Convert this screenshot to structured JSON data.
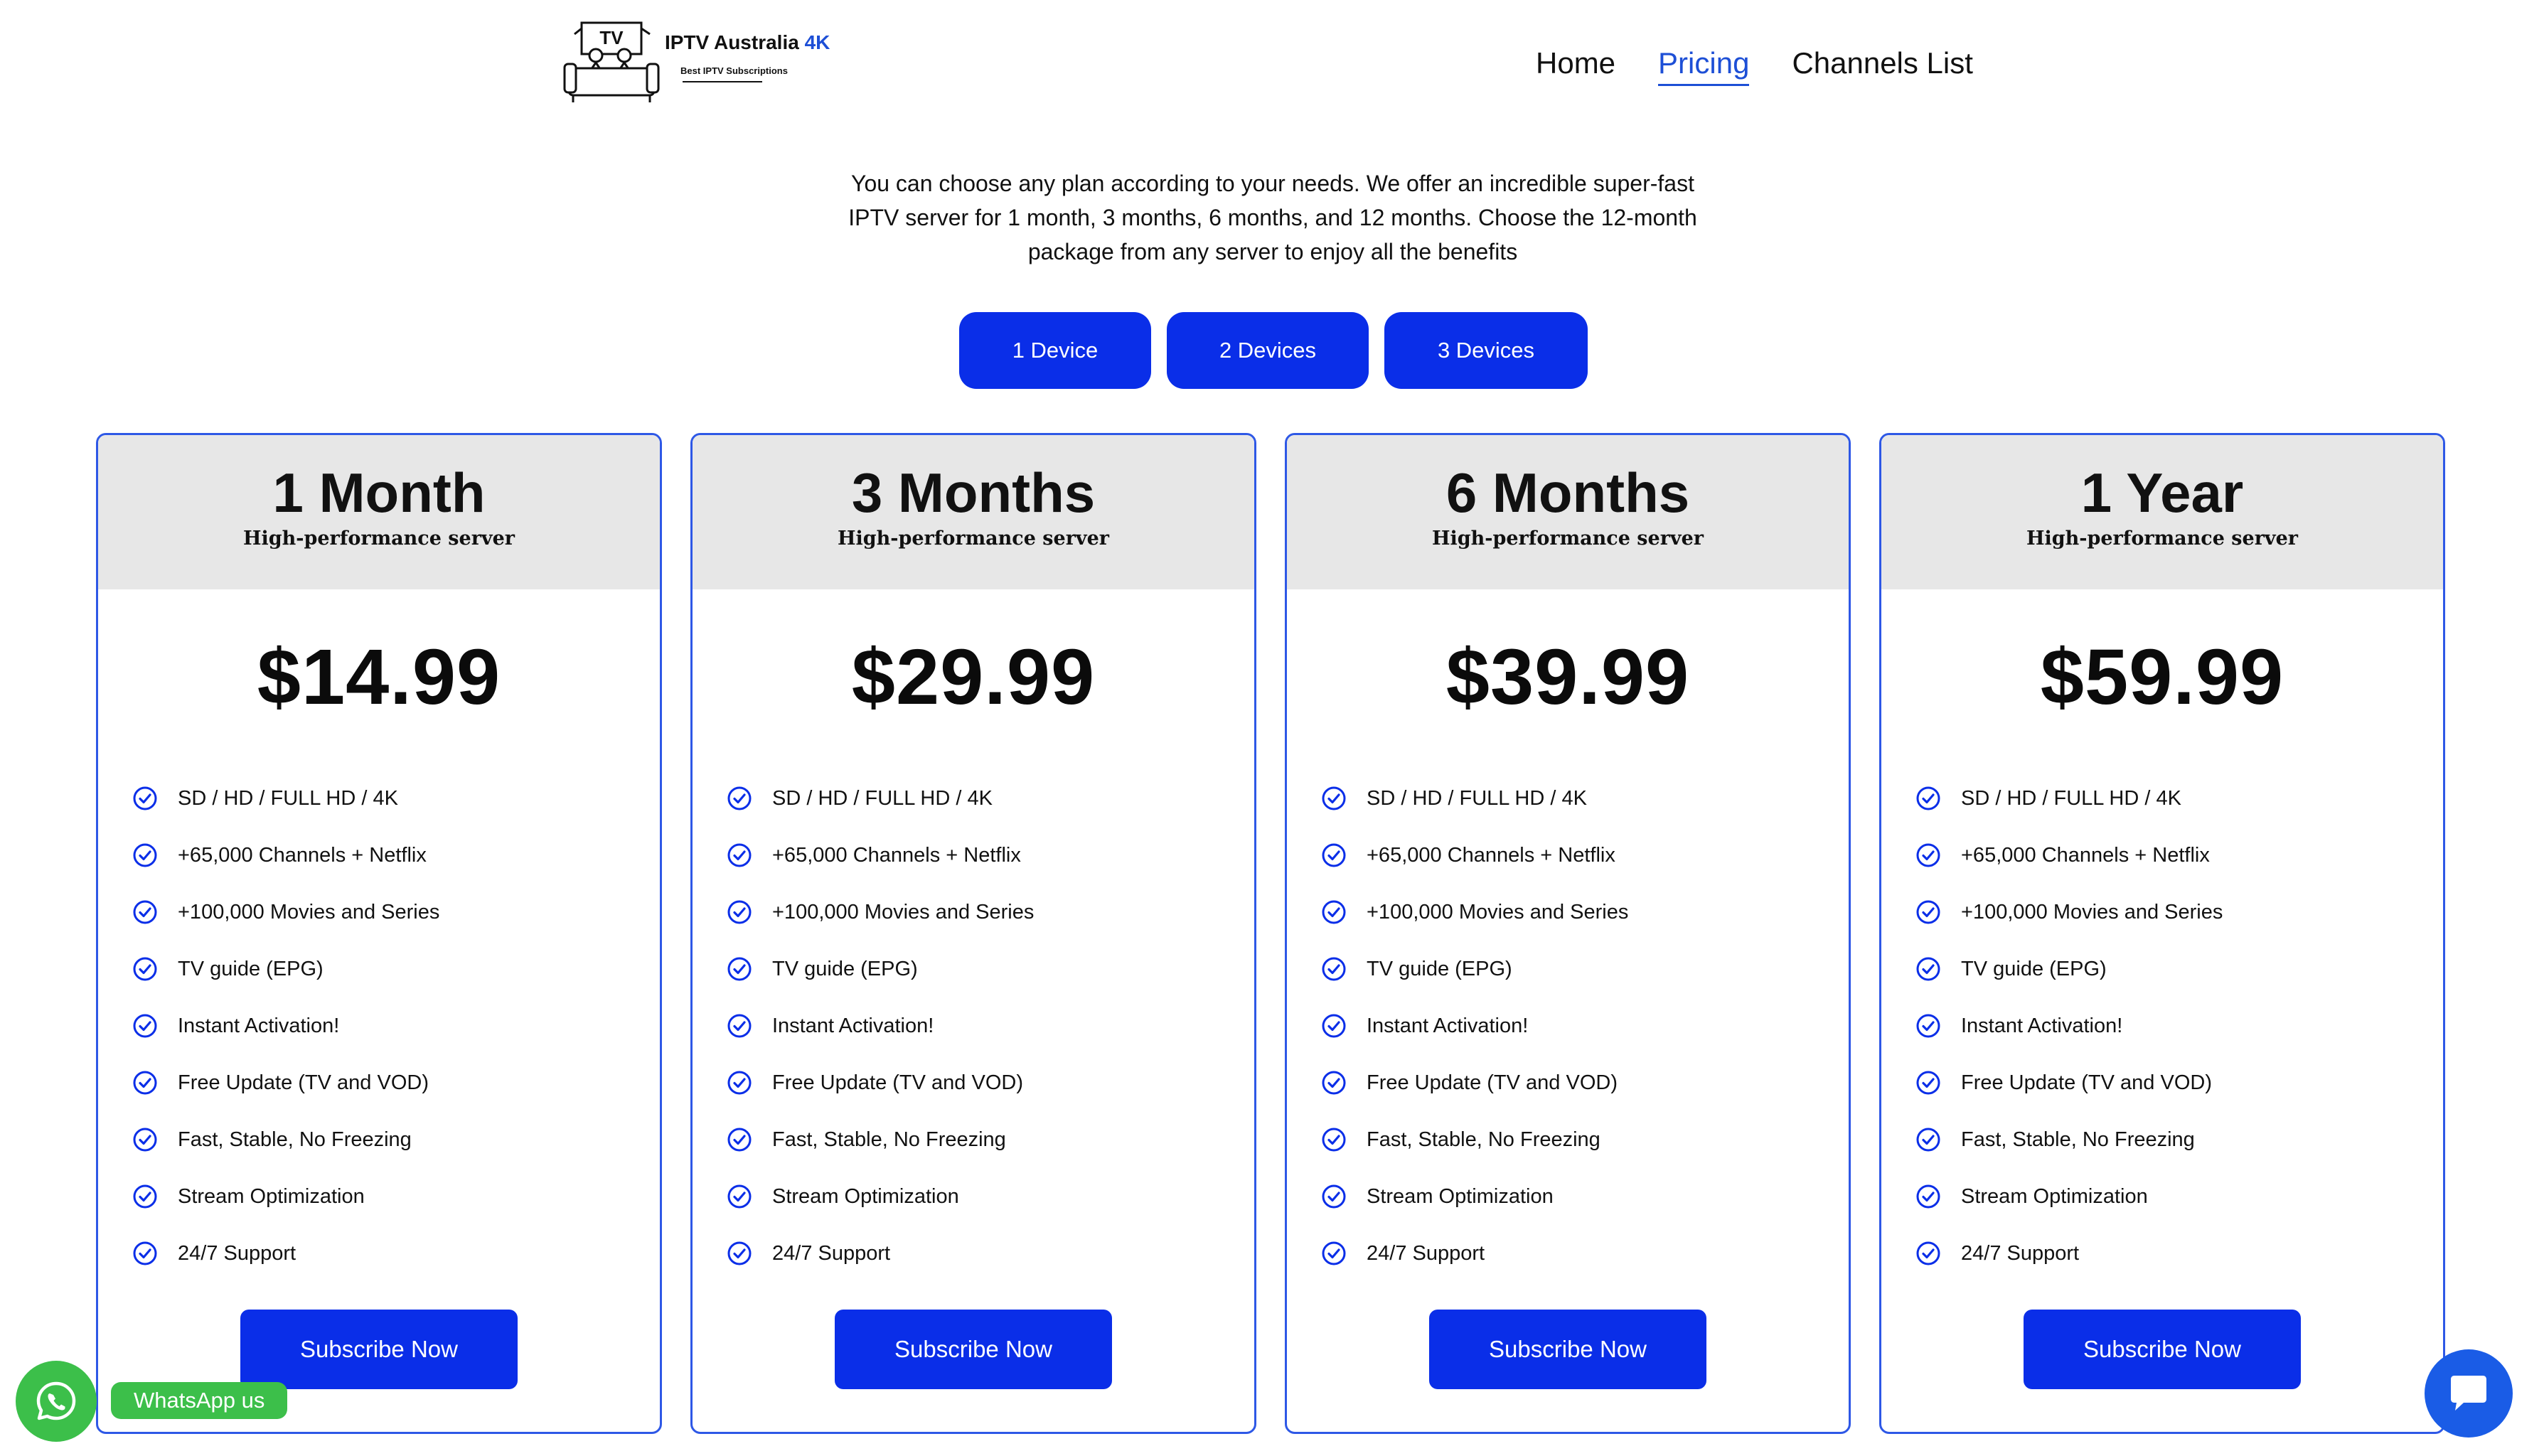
{
  "header": {
    "logo": {
      "art_text": "TV",
      "brand": "IPTV Australia",
      "brand_accent": "4K",
      "tagline": "Best IPTV Subscriptions"
    },
    "nav": [
      {
        "label": "Home",
        "active": false
      },
      {
        "label": "Pricing",
        "active": true
      },
      {
        "label": "Channels List",
        "active": false
      }
    ]
  },
  "intro": {
    "text": "You can choose any plan according to your needs. We offer an incredible super-fast IPTV server for 1 month, 3 months, 6 months, and 12 months. Choose the 12-month package from any server to enjoy all the benefits"
  },
  "device_tabs": [
    {
      "label": "1 Device"
    },
    {
      "label": "2 Devices"
    },
    {
      "label": "3 Devices"
    }
  ],
  "plans": [
    {
      "title": "1 Month",
      "subtitle": "High-performance server",
      "price": "$14.99",
      "features": [
        "SD / HD / FULL HD / 4K",
        "+65,000 Channels + Netflix",
        "+100,000 Movies and Series",
        "TV guide (EPG)",
        "Instant Activation!",
        "Free Update (TV and VOD)",
        "Fast, Stable, No Freezing",
        "Stream Optimization",
        "24/7 Support"
      ],
      "cta": "Subscribe Now"
    },
    {
      "title": "3 Months",
      "subtitle": "High-performance server",
      "price": "$29.99",
      "features": [
        "SD / HD / FULL HD / 4K",
        "+65,000 Channels + Netflix",
        "+100,000 Movies and Series",
        "TV guide (EPG)",
        "Instant Activation!",
        "Free Update (TV and VOD)",
        "Fast, Stable, No Freezing",
        "Stream Optimization",
        "24/7 Support"
      ],
      "cta": "Subscribe Now"
    },
    {
      "title": "6 Months",
      "subtitle": "High-performance server",
      "price": "$39.99",
      "features": [
        "SD / HD / FULL HD / 4K",
        "+65,000 Channels + Netflix",
        "+100,000 Movies and Series",
        "TV guide (EPG)",
        "Instant Activation!",
        "Free Update (TV and VOD)",
        "Fast, Stable, No Freezing",
        "Stream Optimization",
        "24/7 Support"
      ],
      "cta": "Subscribe Now"
    },
    {
      "title": "1 Year",
      "subtitle": "High-performance server",
      "price": "$59.99",
      "features": [
        "SD / HD / FULL HD / 4K",
        "+65,000 Channels + Netflix",
        "+100,000 Movies and Series",
        "TV guide (EPG)",
        "Instant Activation!",
        "Free Update (TV and VOD)",
        "Fast, Stable, No Freezing",
        "Stream Optimization",
        "24/7 Support"
      ],
      "cta": "Subscribe Now"
    }
  ],
  "widgets": {
    "whatsapp_label": "WhatsApp us",
    "whatsapp_icon": "whatsapp-icon",
    "chat_icon": "chat-bubble-icon"
  },
  "colors": {
    "accent": "#0a2ee8",
    "nav_active": "#1d4fd6",
    "card_border": "#2e58e6",
    "card_head_bg": "#e7e7e7",
    "whatsapp_green": "#3cbf4a",
    "chat_blue": "#1a5ce6"
  }
}
